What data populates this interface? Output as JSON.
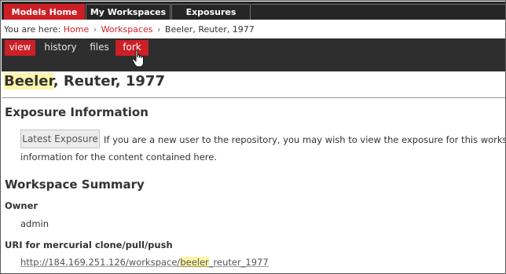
{
  "topnav": {
    "tabs": [
      {
        "label": "Models Home"
      },
      {
        "label": "My Workspaces"
      },
      {
        "label": "Exposures"
      }
    ],
    "active_color": "#cc1f26"
  },
  "breadcrumb": {
    "prefix": "You are here:",
    "items": [
      "Home",
      "Workspaces"
    ],
    "current": "Beeler, Reuter, 1977",
    "separator": "›"
  },
  "content_tabs": {
    "tabs": [
      {
        "label": "view"
      },
      {
        "label": "history"
      },
      {
        "label": "files"
      },
      {
        "label": "fork"
      }
    ]
  },
  "page": {
    "title_highlight": "Beeler",
    "title_rest": ", Reuter, 1977"
  },
  "exposure": {
    "heading": "Exposure Information",
    "button": "Latest Exposure",
    "text_line1": "If you are a new user to the repository, you may wish to view the exposure for this works",
    "text_line2": "information for the content contained here."
  },
  "summary": {
    "heading": "Workspace Summary",
    "owner_label": "Owner",
    "owner_value": "admin",
    "uri_label": "URI for mercurial clone/pull/push",
    "uri_prefix": "http://184.169.251.126/workspace/",
    "uri_highlight": "beeler",
    "uri_suffix": "_reuter_1977"
  }
}
